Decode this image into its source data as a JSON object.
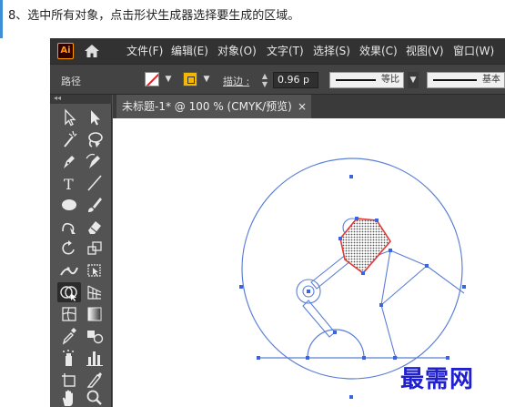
{
  "caption": {
    "text": "8、选中所有对象，点击形状生成器选择要生成的区域。"
  },
  "app": {
    "logo": "Ai",
    "menu": [
      "文件(F)",
      "编辑(E)",
      "对象(O)",
      "文字(T)",
      "选择(S)",
      "效果(C)",
      "视图(V)",
      "窗口(W)"
    ]
  },
  "control_bar": {
    "selection_label": "路径",
    "stroke_label": "描边 :",
    "stroke_value": "0.96 p",
    "profile_label": "等比",
    "brush_label": "基本",
    "fill_color": "#ffffff",
    "stroke_color": "#f5b800"
  },
  "toolbar": {
    "tools": [
      "selection-tool-icon",
      "direct-selection-tool-icon",
      "magic-wand-tool-icon",
      "lasso-tool-icon",
      "pen-tool-icon",
      "curvature-tool-icon",
      "type-tool-icon",
      "line-segment-tool-icon",
      "ellipse-tool-icon",
      "paintbrush-tool-icon",
      "shaper-tool-icon",
      "eraser-tool-icon",
      "rotate-tool-icon",
      "scale-tool-icon",
      "width-tool-icon",
      "free-transform-tool-icon",
      "shape-builder-tool-icon",
      "perspective-grid-tool-icon",
      "mesh-tool-icon",
      "gradient-tool-icon",
      "eyedropper-tool-icon",
      "blend-tool-icon",
      "symbol-sprayer-tool-icon",
      "column-graph-tool-icon",
      "artboard-tool-icon",
      "slice-tool-icon",
      "hand-tool-icon",
      "zoom-tool-icon"
    ],
    "active_tool": "shape-builder-tool-icon"
  },
  "document": {
    "tab_title": "未标题-1* @ 100 % (CMYK/预览)",
    "tab_close": "×"
  },
  "watermark": {
    "text": "最需网"
  }
}
